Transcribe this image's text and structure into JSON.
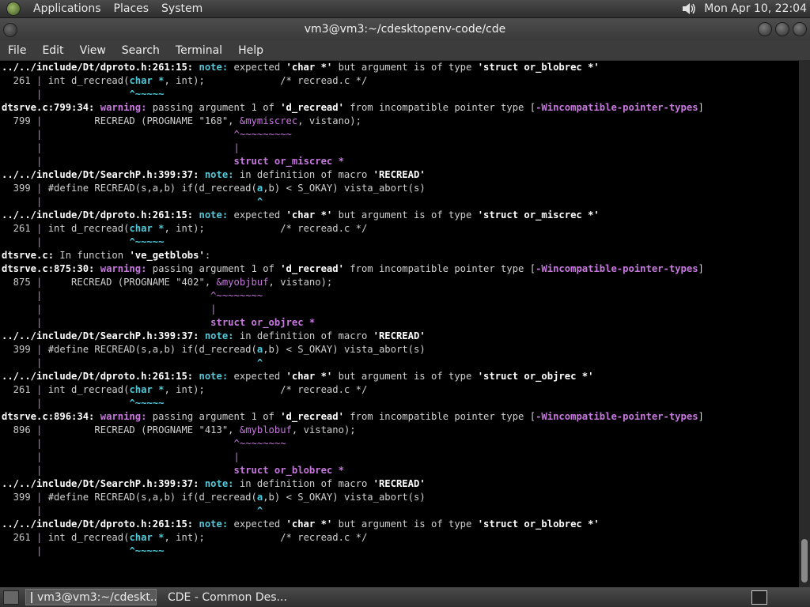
{
  "top_panel": {
    "menus": [
      "Applications",
      "Places",
      "System"
    ],
    "clock": "Mon Apr 10, 22:04",
    "volume_icon": "speaker-icon"
  },
  "window": {
    "title": "vm3@vm3:~/cdesktopenv-code/cde"
  },
  "menubar": [
    "File",
    "Edit",
    "View",
    "Search",
    "Terminal",
    "Help"
  ],
  "colors": {
    "warning": "#c678dd",
    "note": "#56c6d6",
    "background": "#000000"
  },
  "terminal": {
    "lines": [
      [
        [
          "b",
          "../../include/Dt/dproto.h:261:15:"
        ],
        [
          "n",
          " "
        ],
        [
          "note",
          "note:"
        ],
        [
          "n",
          " expected "
        ],
        [
          "b",
          "'char *'"
        ],
        [
          "n",
          " but argument is of type "
        ],
        [
          "b",
          "'struct or_blobrec *'"
        ]
      ],
      [
        [
          "ln",
          "  261 "
        ],
        [
          "pipe",
          "|"
        ],
        [
          "n",
          " int d_recread("
        ],
        [
          "cy",
          "char *"
        ],
        [
          "n",
          ", int);             /* recread.c */"
        ]
      ],
      [
        [
          "ln",
          "      "
        ],
        [
          "pipe",
          "|"
        ],
        [
          "n",
          "               "
        ],
        [
          "cy",
          "^~~~~~"
        ]
      ],
      [
        [
          "b",
          "dtsrve.c:799:34:"
        ],
        [
          "n",
          " "
        ],
        [
          "warn",
          "warning:"
        ],
        [
          "n",
          " passing argument 1 of "
        ],
        [
          "b",
          "'d_recread'"
        ],
        [
          "n",
          " from incompatible pointer type ["
        ],
        [
          "grn",
          "-Wincompatible-pointer-types"
        ],
        [
          "n",
          "]"
        ]
      ],
      [
        [
          "ln",
          "  799 "
        ],
        [
          "pipe",
          "|"
        ],
        [
          "n",
          "         RECREAD (PROGNAME \"168\", "
        ],
        [
          "mag",
          "&mymiscrec"
        ],
        [
          "n",
          ", vistano);"
        ]
      ],
      [
        [
          "ln",
          "      "
        ],
        [
          "pipe",
          "|"
        ],
        [
          "n",
          "                                 "
        ],
        [
          "mag",
          "^~~~~~~~~~"
        ]
      ],
      [
        [
          "ln",
          "      "
        ],
        [
          "pipe",
          "|"
        ],
        [
          "n",
          "                                 "
        ],
        [
          "mag",
          "|"
        ]
      ],
      [
        [
          "ln",
          "      "
        ],
        [
          "pipe",
          "|"
        ],
        [
          "n",
          "                                 "
        ],
        [
          "grn",
          "struct or_miscrec *"
        ]
      ],
      [
        [
          "b",
          "../../include/Dt/SearchP.h:399:37:"
        ],
        [
          "n",
          " "
        ],
        [
          "note",
          "note:"
        ],
        [
          "n",
          " in definition of macro "
        ],
        [
          "b",
          "'RECREAD'"
        ]
      ],
      [
        [
          "ln",
          "  399 "
        ],
        [
          "pipe",
          "|"
        ],
        [
          "n",
          " #define RECREAD(s,a,b) if(d_recread("
        ],
        [
          "cy",
          "a"
        ],
        [
          "n",
          ",b) < S_OKAY) vista_abort(s)"
        ]
      ],
      [
        [
          "ln",
          "      "
        ],
        [
          "pipe",
          "|"
        ],
        [
          "n",
          "                                     "
        ],
        [
          "cy",
          "^"
        ]
      ],
      [
        [
          "b",
          "../../include/Dt/dproto.h:261:15:"
        ],
        [
          "n",
          " "
        ],
        [
          "note",
          "note:"
        ],
        [
          "n",
          " expected "
        ],
        [
          "b",
          "'char *'"
        ],
        [
          "n",
          " but argument is of type "
        ],
        [
          "b",
          "'struct or_miscrec *'"
        ]
      ],
      [
        [
          "ln",
          "  261 "
        ],
        [
          "pipe",
          "|"
        ],
        [
          "n",
          " int d_recread("
        ],
        [
          "cy",
          "char *"
        ],
        [
          "n",
          ", int);             /* recread.c */"
        ]
      ],
      [
        [
          "ln",
          "      "
        ],
        [
          "pipe",
          "|"
        ],
        [
          "n",
          "               "
        ],
        [
          "cy",
          "^~~~~~"
        ]
      ],
      [
        [
          "b",
          "dtsrve.c:"
        ],
        [
          "n",
          " In function "
        ],
        [
          "b",
          "'ve_getblobs'"
        ],
        [
          "n",
          ":"
        ]
      ],
      [
        [
          "b",
          "dtsrve.c:875:30:"
        ],
        [
          "n",
          " "
        ],
        [
          "warn",
          "warning:"
        ],
        [
          "n",
          " passing argument 1 of "
        ],
        [
          "b",
          "'d_recread'"
        ],
        [
          "n",
          " from incompatible pointer type ["
        ],
        [
          "grn",
          "-Wincompatible-pointer-types"
        ],
        [
          "n",
          "]"
        ]
      ],
      [
        [
          "ln",
          "  875 "
        ],
        [
          "pipe",
          "|"
        ],
        [
          "n",
          "     RECREAD (PROGNAME \"402\", "
        ],
        [
          "mag",
          "&myobjbuf"
        ],
        [
          "n",
          ", vistano);"
        ]
      ],
      [
        [
          "ln",
          "      "
        ],
        [
          "pipe",
          "|"
        ],
        [
          "n",
          "                             "
        ],
        [
          "mag",
          "^~~~~~~~~"
        ]
      ],
      [
        [
          "ln",
          "      "
        ],
        [
          "pipe",
          "|"
        ],
        [
          "n",
          "                             "
        ],
        [
          "mag",
          "|"
        ]
      ],
      [
        [
          "ln",
          "      "
        ],
        [
          "pipe",
          "|"
        ],
        [
          "n",
          "                             "
        ],
        [
          "grn",
          "struct or_objrec *"
        ]
      ],
      [
        [
          "b",
          "../../include/Dt/SearchP.h:399:37:"
        ],
        [
          "n",
          " "
        ],
        [
          "note",
          "note:"
        ],
        [
          "n",
          " in definition of macro "
        ],
        [
          "b",
          "'RECREAD'"
        ]
      ],
      [
        [
          "ln",
          "  399 "
        ],
        [
          "pipe",
          "|"
        ],
        [
          "n",
          " #define RECREAD(s,a,b) if(d_recread("
        ],
        [
          "cy",
          "a"
        ],
        [
          "n",
          ",b) < S_OKAY) vista_abort(s)"
        ]
      ],
      [
        [
          "ln",
          "      "
        ],
        [
          "pipe",
          "|"
        ],
        [
          "n",
          "                                     "
        ],
        [
          "cy",
          "^"
        ]
      ],
      [
        [
          "b",
          "../../include/Dt/dproto.h:261:15:"
        ],
        [
          "n",
          " "
        ],
        [
          "note",
          "note:"
        ],
        [
          "n",
          " expected "
        ],
        [
          "b",
          "'char *'"
        ],
        [
          "n",
          " but argument is of type "
        ],
        [
          "b",
          "'struct or_objrec *'"
        ]
      ],
      [
        [
          "ln",
          "  261 "
        ],
        [
          "pipe",
          "|"
        ],
        [
          "n",
          " int d_recread("
        ],
        [
          "cy",
          "char *"
        ],
        [
          "n",
          ", int);             /* recread.c */"
        ]
      ],
      [
        [
          "ln",
          "      "
        ],
        [
          "pipe",
          "|"
        ],
        [
          "n",
          "               "
        ],
        [
          "cy",
          "^~~~~~"
        ]
      ],
      [
        [
          "b",
          "dtsrve.c:896:34:"
        ],
        [
          "n",
          " "
        ],
        [
          "warn",
          "warning:"
        ],
        [
          "n",
          " passing argument 1 of "
        ],
        [
          "b",
          "'d_recread'"
        ],
        [
          "n",
          " from incompatible pointer type ["
        ],
        [
          "grn",
          "-Wincompatible-pointer-types"
        ],
        [
          "n",
          "]"
        ]
      ],
      [
        [
          "ln",
          "  896 "
        ],
        [
          "pipe",
          "|"
        ],
        [
          "n",
          "         RECREAD (PROGNAME \"413\", "
        ],
        [
          "mag",
          "&myblobuf"
        ],
        [
          "n",
          ", vistano);"
        ]
      ],
      [
        [
          "ln",
          "      "
        ],
        [
          "pipe",
          "|"
        ],
        [
          "n",
          "                                 "
        ],
        [
          "mag",
          "^~~~~~~~~"
        ]
      ],
      [
        [
          "ln",
          "      "
        ],
        [
          "pipe",
          "|"
        ],
        [
          "n",
          "                                 "
        ],
        [
          "mag",
          "|"
        ]
      ],
      [
        [
          "ln",
          "      "
        ],
        [
          "pipe",
          "|"
        ],
        [
          "n",
          "                                 "
        ],
        [
          "grn",
          "struct or_blobrec *"
        ]
      ],
      [
        [
          "b",
          "../../include/Dt/SearchP.h:399:37:"
        ],
        [
          "n",
          " "
        ],
        [
          "note",
          "note:"
        ],
        [
          "n",
          " in definition of macro "
        ],
        [
          "b",
          "'RECREAD'"
        ]
      ],
      [
        [
          "ln",
          "  399 "
        ],
        [
          "pipe",
          "|"
        ],
        [
          "n",
          " #define RECREAD(s,a,b) if(d_recread("
        ],
        [
          "cy",
          "a"
        ],
        [
          "n",
          ",b) < S_OKAY) vista_abort(s)"
        ]
      ],
      [
        [
          "ln",
          "      "
        ],
        [
          "pipe",
          "|"
        ],
        [
          "n",
          "                                     "
        ],
        [
          "cy",
          "^"
        ]
      ],
      [
        [
          "b",
          "../../include/Dt/dproto.h:261:15:"
        ],
        [
          "n",
          " "
        ],
        [
          "note",
          "note:"
        ],
        [
          "n",
          " expected "
        ],
        [
          "b",
          "'char *'"
        ],
        [
          "n",
          " but argument is of type "
        ],
        [
          "b",
          "'struct or_blobrec *'"
        ]
      ],
      [
        [
          "ln",
          "  261 "
        ],
        [
          "pipe",
          "|"
        ],
        [
          "n",
          " int d_recread("
        ],
        [
          "cy",
          "char *"
        ],
        [
          "n",
          ", int);             /* recread.c */"
        ]
      ],
      [
        [
          "ln",
          "      "
        ],
        [
          "pipe",
          "|"
        ],
        [
          "n",
          "               "
        ],
        [
          "cy",
          "^~~~~~"
        ]
      ]
    ]
  },
  "taskbar": {
    "tasks": [
      {
        "label": "vm3@vm3:~/cdeskt...",
        "icon": "terminal-icon",
        "active": true
      },
      {
        "label": "CDE - Common Des...",
        "icon": "firefox-icon",
        "active": false
      }
    ]
  }
}
